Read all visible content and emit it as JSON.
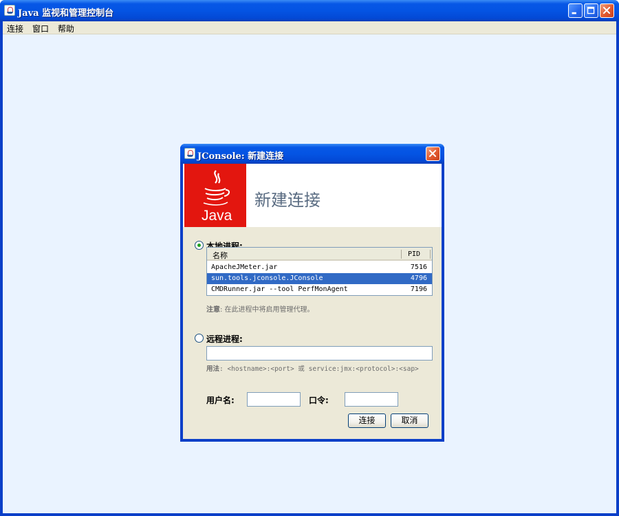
{
  "window": {
    "title": "Java 监视和管理控制台"
  },
  "menu": {
    "items": [
      "连接",
      "窗口",
      "帮助"
    ]
  },
  "dialog": {
    "title": "JConsole: 新建连接",
    "heading": "新建连接",
    "logo_text": "Java",
    "local": {
      "label": "本地进程:",
      "selected": true,
      "columns": {
        "name": "名称",
        "pid": "PID"
      },
      "rows": [
        {
          "name": "ApacheJMeter.jar",
          "pid": "7516",
          "selected": false
        },
        {
          "name": "sun.tools.jconsole.JConsole",
          "pid": "4796",
          "selected": true
        },
        {
          "name": "CMDRunner.jar --tool PerfMonAgent",
          "pid": "7196",
          "selected": false
        }
      ],
      "note_label": "注意",
      "note_text": ": 在此进程中将启用管理代理。"
    },
    "remote": {
      "label": "远程进程:",
      "selected": false,
      "url_value": "",
      "usage_label": "用法",
      "usage_text": ": <hostname>:<port> 或 service:jmx:<protocol>:<sap>"
    },
    "username_label": "用户名:",
    "username_value": "",
    "password_label": "口令:",
    "password_value": "",
    "connect_button": "连接",
    "cancel_button": "取消"
  },
  "colors": {
    "titlebar": "#0454e3",
    "desktop": "#eaf3ff",
    "dialog_bg": "#ece9d8",
    "java_red": "#e3160f",
    "selection": "#316ac5",
    "close_button": "#e2592e"
  },
  "icons": [
    "java-app-icon",
    "minimize-icon",
    "maximize-icon",
    "close-icon",
    "java-logo-icon"
  ]
}
